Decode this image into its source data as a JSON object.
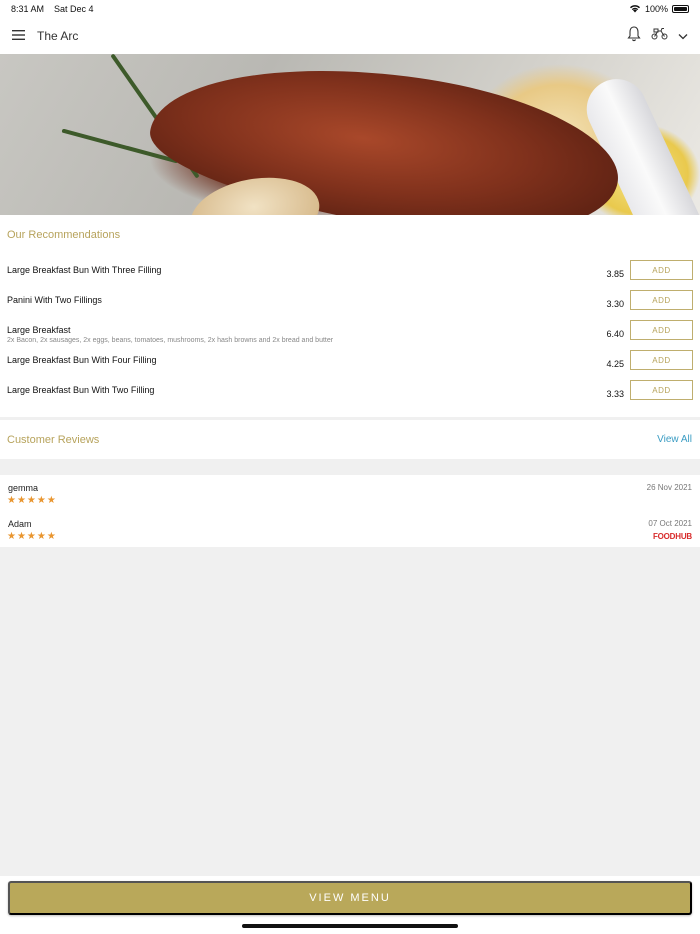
{
  "status_bar": {
    "time": "8:31 AM",
    "date": "Sat Dec 4",
    "battery": "100%"
  },
  "header": {
    "title": "The Arc",
    "icons": [
      "menu-icon",
      "bell-icon",
      "delivery-scooter-icon",
      "chevron-down-icon"
    ]
  },
  "recommendations": {
    "title": "Our Recommendations",
    "add_label": "ADD",
    "items": [
      {
        "name": "Large Breakfast Bun With Three Filling",
        "description": "",
        "price": "3.85"
      },
      {
        "name": "Panini With Two Fillings",
        "description": "",
        "price": "3.30"
      },
      {
        "name": "Large Breakfast",
        "description": "2x Bacon, 2x sausages, 2x eggs, beans, tomatoes, mushrooms, 2x hash browns and 2x bread and butter",
        "price": "6.40"
      },
      {
        "name": "Large Breakfast Bun With Four Filling",
        "description": "",
        "price": "4.25"
      },
      {
        "name": "Large Breakfast Bun With Two Filling",
        "description": "",
        "price": "3.33"
      }
    ]
  },
  "reviews": {
    "title": "Customer Reviews",
    "view_all": "View All",
    "items": [
      {
        "name": "gemma",
        "rating": 5,
        "stars": "★★★★★",
        "date": "26 Nov 2021",
        "source": ""
      },
      {
        "name": "Adam",
        "rating": 5,
        "stars": "★★★★★",
        "date": "07 Oct 2021",
        "source": "FOODHUB"
      }
    ]
  },
  "footer": {
    "view_menu": "VIEW MENU"
  },
  "colors": {
    "accent": "#b9a85a",
    "link": "#3a9cc3",
    "star": "#e99630",
    "foodhub": "#d82b2b"
  }
}
